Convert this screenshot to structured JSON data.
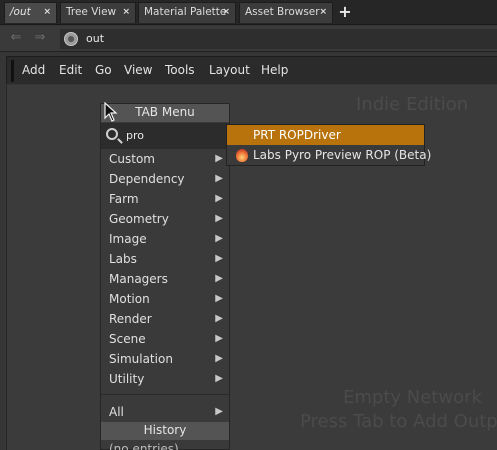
{
  "tabs": [
    {
      "label": "/out",
      "active": true
    },
    {
      "label": "Tree View",
      "active": false
    },
    {
      "label": "Material Palette",
      "active": false
    },
    {
      "label": "Asset Browser",
      "active": false
    }
  ],
  "tab_close_glyph": "×",
  "add_tab_glyph": "+",
  "pathbar": {
    "back_glyph": "⇐",
    "forward_glyph": "⇒",
    "path": "out",
    "path_icon": "network-context-icon"
  },
  "menubar": [
    "Add",
    "Edit",
    "Go",
    "View",
    "Tools",
    "Layout",
    "Help"
  ],
  "network": {
    "watermark": "Indie Edition",
    "empty_line1": "Empty Network",
    "empty_line2": "Press Tab to Add Outp"
  },
  "tab_menu": {
    "title": "TAB Menu",
    "search_value": "pro",
    "search_icon": "search-icon",
    "categories": [
      "Custom",
      "Dependency",
      "Farm",
      "Geometry",
      "Image",
      "Labs",
      "Managers",
      "Motion",
      "Render",
      "Scene",
      "Simulation",
      "Utility"
    ],
    "all_label": "All",
    "submenu_arrow": "▶",
    "history_title": "History",
    "history_empty": "(no entries)"
  },
  "results": [
    {
      "label": "PRT ROPDriver",
      "selected": true,
      "icon": null
    },
    {
      "label": "Labs Pyro Preview ROP (Beta)",
      "selected": false,
      "icon": "pyro-flame-icon"
    }
  ],
  "colors": {
    "selection": "#b8730c",
    "background": "#3b3b3b"
  }
}
